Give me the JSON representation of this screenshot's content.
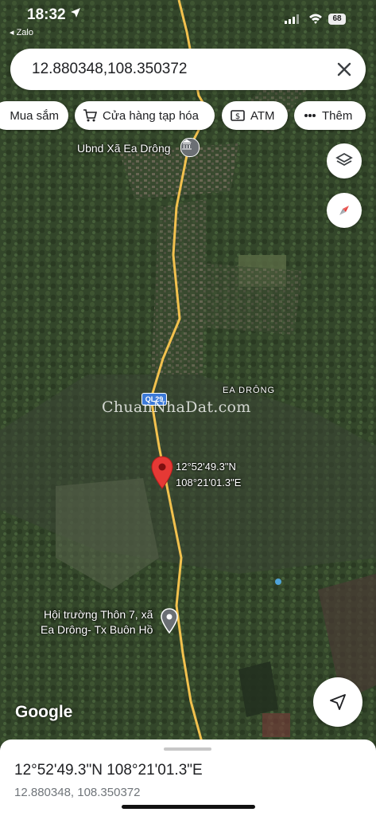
{
  "status": {
    "time": "18:32",
    "back_app": "◂ Zalo",
    "battery": "68"
  },
  "search": {
    "query": "12.880348,108.350372"
  },
  "chips": [
    {
      "label": "Mua sắm",
      "icon": "shopping-bag-icon"
    },
    {
      "label": "Cửa hàng tạp hóa",
      "icon": "shopping-cart-icon"
    },
    {
      "label": "ATM",
      "icon": "atm-icon"
    },
    {
      "label": "Thêm",
      "icon": "more-dots-icon"
    }
  ],
  "map": {
    "place_top": "Ubnd Xã Ea Drông",
    "area_label": "EA DRÔNG",
    "road_label": "QL29",
    "pin_lat": "12°52'49.3\"N",
    "pin_lng": "108°21'01.3\"E",
    "place_bottom_line1": "Hội trường Thôn 7, xã",
    "place_bottom_line2": "Ea Drông- Tx Buôn Hồ",
    "watermark": "ChuanNhaDat.com",
    "attribution": "Google"
  },
  "sheet": {
    "dms": "12°52'49.3\"N 108°21'01.3\"E",
    "decimal": "12.880348, 108.350372"
  },
  "colors": {
    "pin": "#e53935",
    "road": "#f2c14e",
    "map_dark": "#2b3a24"
  }
}
